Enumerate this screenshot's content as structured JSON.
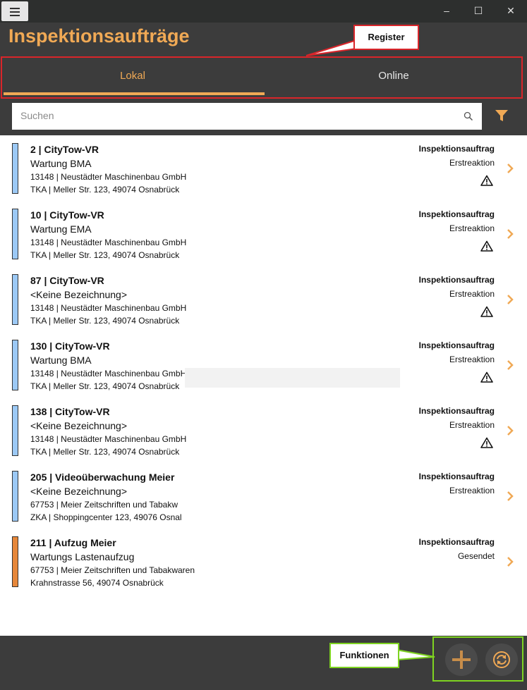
{
  "window": {
    "title": "Inspektionsaufträge",
    "controls": {
      "minimize": "–",
      "maximize": "☐",
      "close": "✕"
    }
  },
  "tabs": [
    {
      "label": "Lokal",
      "active": true
    },
    {
      "label": "Online",
      "active": false
    }
  ],
  "callouts": {
    "register": "Register",
    "funktionen": "Funktionen"
  },
  "search": {
    "placeholder": "Suchen",
    "value": ""
  },
  "colors": {
    "accent": "#f0a955",
    "bar_blue": "#9cc9f5",
    "bar_orange": "#e6873a",
    "callout_red": "#d9252a",
    "callout_green": "#7ed321"
  },
  "icons": {
    "menu": "hamburger-icon",
    "search": "search-icon",
    "filter": "filter-icon",
    "warning": "warning-icon",
    "chevron": "chevron-right-icon",
    "add": "plus-icon",
    "sync": "sync-icon"
  },
  "orders": [
    {
      "title": "2  |  CityTow-VR",
      "desc": "Wartung BMA",
      "line3": "13148  |  Neustädter Maschinenbau GmbH",
      "line4": "TKA  |  Meller Str. 123, 49074 Osnabrück",
      "type": "Inspektionsauftrag",
      "status": "Erstreaktion",
      "warning": true,
      "color": "blue"
    },
    {
      "title": "10  |  CityTow-VR",
      "desc": "Wartung EMA",
      "line3": "13148  |  Neustädter Maschinenbau GmbH",
      "line4": "TKA  |  Meller Str. 123, 49074 Osnabrück",
      "type": "Inspektionsauftrag",
      "status": "Erstreaktion",
      "warning": true,
      "color": "blue"
    },
    {
      "title": "87  |  CityTow-VR",
      "desc": "<Keine Bezeichnung>",
      "line3": "13148  |  Neustädter Maschinenbau GmbH",
      "line4": "TKA  |  Meller Str. 123, 49074 Osnabrück",
      "type": "Inspektionsauftrag",
      "status": "Erstreaktion",
      "warning": true,
      "color": "blue"
    },
    {
      "title": "130  |  CityTow-VR",
      "desc": "Wartung BMA",
      "line3": "13148  |  Neustädter Maschinenbau GmbH",
      "line4": "TKA  |  Meller Str. 123, 49074 Osnabrück",
      "type": "Inspektionsauftrag",
      "status": "Erstreaktion",
      "warning": true,
      "color": "blue"
    },
    {
      "title": "138  |  CityTow-VR",
      "desc": "<Keine Bezeichnung>",
      "line3": "13148  |  Neustädter Maschinenbau GmbH",
      "line4": "TKA  |  Meller Str. 123, 49074 Osnabrück",
      "type": "Inspektionsauftrag",
      "status": "Erstreaktion",
      "warning": true,
      "color": "blue"
    },
    {
      "title": "205  |  Videoüberwachung Meier",
      "desc": "<Keine Bezeichnung>",
      "line3": "67753  |  Meier Zeitschriften und Tabakw",
      "line4": "ZKA  |  Shoppingcenter 123, 49076 Osnal",
      "type": "Inspektionsauftrag",
      "status": "Erstreaktion",
      "warning": false,
      "color": "blue"
    },
    {
      "title": "211  |  Aufzug Meier",
      "desc": "Wartungs Lastenaufzug",
      "line3": "67753  |  Meier Zeitschriften und Tabakwaren",
      "line4": "Krahnstrasse 56, 49074 Osnabrück",
      "type": "Inspektionsauftrag",
      "status": "Gesendet",
      "warning": false,
      "color": "orange"
    }
  ]
}
